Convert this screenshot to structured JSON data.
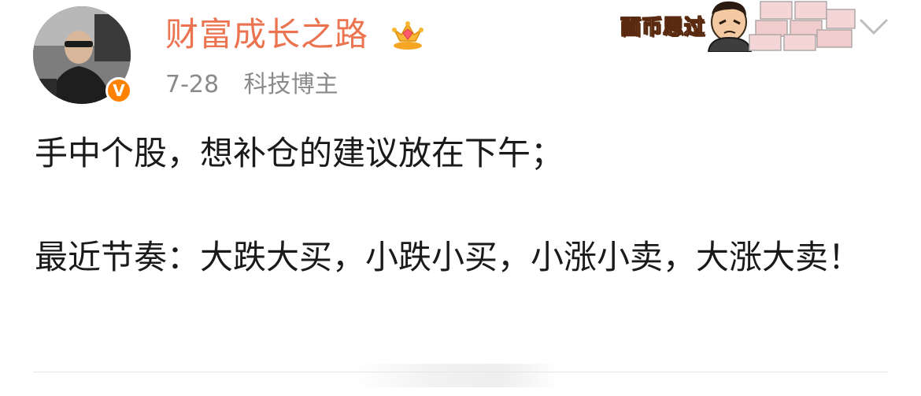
{
  "user": {
    "name": "财富成长之路",
    "verified_badge": "V",
    "avatar_icon": "avatar-photo"
  },
  "meta": {
    "date": "7-28",
    "role": "科技博主"
  },
  "sticker": {
    "text": "面币思过"
  },
  "post": {
    "line1": "手中个股，想补仓的建议放在下午；",
    "line2": "最近节奏：大跌大买，小跌小买，小涨小卖，大涨大卖！"
  },
  "colors": {
    "username": "#eb7350",
    "meta": "#8a8a8a",
    "verified": "#ff8200",
    "text": "#1a1a1a"
  },
  "icons": [
    "crown-icon",
    "verified-icon",
    "chevron-down-icon"
  ]
}
